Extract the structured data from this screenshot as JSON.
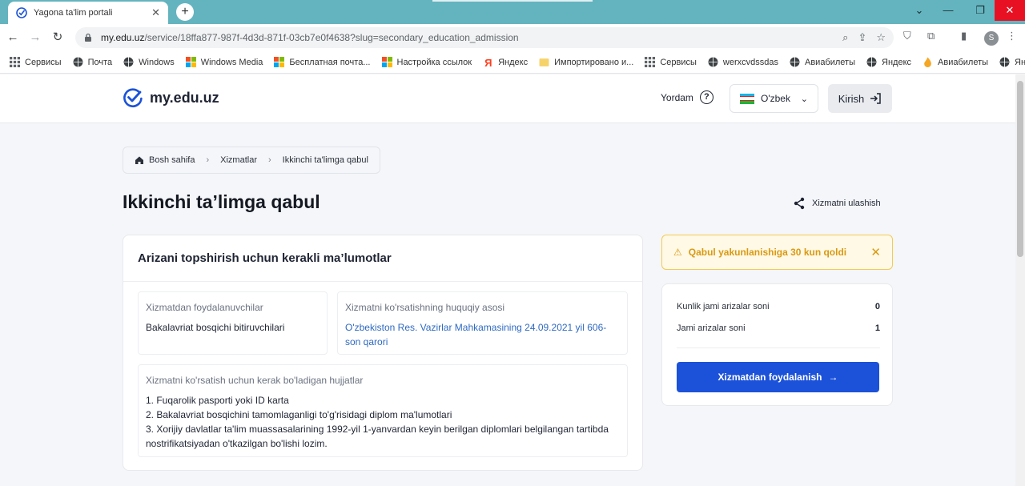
{
  "browser": {
    "tab_title": "Yagona ta'lim portali",
    "url_host": "my.edu.uz",
    "url_path": "/service/18ffa877-987f-4d3d-871f-03cb7e0f4638?slug=secondary_education_admission",
    "profile_letter": "S",
    "bookmarks": [
      {
        "label": "Сервисы",
        "icon": "apps-grid-icon"
      },
      {
        "label": "Почта",
        "icon": "globe-icon"
      },
      {
        "label": "Windows",
        "icon": "globe-icon"
      },
      {
        "label": "Windows Media",
        "icon": "windows-logo-icon"
      },
      {
        "label": "Бесплатная почта...",
        "icon": "windows-logo-icon"
      },
      {
        "label": "Настройка ссылок",
        "icon": "windows-logo-icon"
      },
      {
        "label": "Яндекс",
        "icon": "yandex-icon"
      },
      {
        "label": "Импортировано и...",
        "icon": "folder-icon"
      },
      {
        "label": "Сервисы",
        "icon": "apps-grid-icon"
      },
      {
        "label": "werxcvdssdas",
        "icon": "globe-icon"
      },
      {
        "label": "Авиабилеты",
        "icon": "globe-icon"
      },
      {
        "label": "Яндекс",
        "icon": "globe-icon"
      },
      {
        "label": "Авиабилеты",
        "icon": "flame-icon"
      },
      {
        "label": "Яндекс",
        "icon": "globe-icon"
      }
    ]
  },
  "header": {
    "logo_text": "my.edu.uz",
    "help_label": "Yordam",
    "language": "O'zbek",
    "login_label": "Kirish"
  },
  "breadcrumb": {
    "home": "Bosh sahifa",
    "services": "Xizmatlar",
    "current": "Ikkinchi ta'limga qabul"
  },
  "page": {
    "title": "Ikkinchi ta’limga qabul",
    "share_label": "Xizmatni ulashish"
  },
  "main_card": {
    "heading": "Arizani topshirish uchun kerakli ma’lumotlar",
    "beneficiaries_label": "Xizmatdan foydalanuvchilar",
    "beneficiaries_value": "Bakalavriat bosqichi bitiruvchilari",
    "legal_label": "Xizmatni ko'rsatishning huquqiy asosi",
    "legal_value": "O'zbekiston Res. Vazirlar Mahkamasining 24.09.2021 yil 606-son qarori",
    "docs_label": "Xizmatni ko'rsatish uchun kerak bo'ladigan hujjatlar",
    "docs": [
      "1. Fuqarolik pasporti yoki ID karta",
      "2. Bakalavriat bosqichini tamomlaganligi to'g'risidagi diplom ma'lumotlari",
      "3. Xorijiy davlatlar ta'lim muassasalarining 1992-yil 1-yanvardan keyin berilgan diplomlari belgilangan tartibda nostrifikatsiyadan o'tkazilgan bo'lishi lozim."
    ]
  },
  "alert": {
    "text": "Qabul yakunlanishiga 30 kun qoldi",
    "color": "#d99a12"
  },
  "stats": {
    "daily_label": "Kunlik jami arizalar soni",
    "daily_value": "0",
    "total_label": "Jami arizalar soni",
    "total_value": "1",
    "button_label": "Xizmatdan foydalanish"
  },
  "colors": {
    "primary": "#1c52d9",
    "link": "#2f6ac2",
    "tabbar": "#64b4bf"
  }
}
